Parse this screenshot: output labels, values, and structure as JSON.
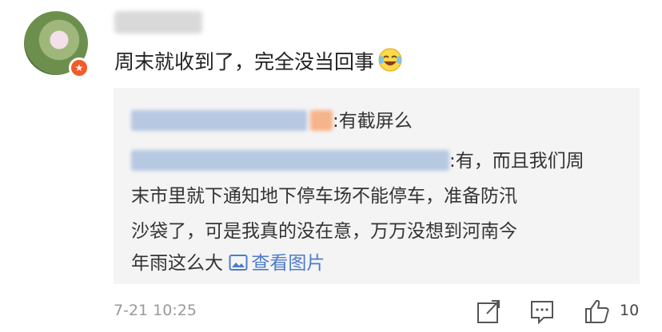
{
  "comment": {
    "text": "周末就收到了，完全没当回事"
  },
  "reply1": {
    "text": ":有截屏么"
  },
  "reply2": {
    "lines": [
      ":有，而且我们周",
      "末市里就下通知地下停车场不能停车，准备防汛",
      "沙袋了，可是我真的没在意，万万没想到河南今",
      "年雨这么大"
    ],
    "link_text": "查看图片"
  },
  "meta": {
    "timestamp": "7-21 10:25",
    "like_count": "10"
  },
  "icons": {
    "avatar_badge": "star-badge-icon",
    "emoji": "laughing-crying-emoji",
    "image_link": "image-icon",
    "share": "share-icon",
    "comment": "comment-icon",
    "like": "thumbs-up-icon"
  },
  "colors": {
    "link": "#4f7bc9",
    "badge": "#f25b2b",
    "reply_background": "#f4f4f4"
  }
}
